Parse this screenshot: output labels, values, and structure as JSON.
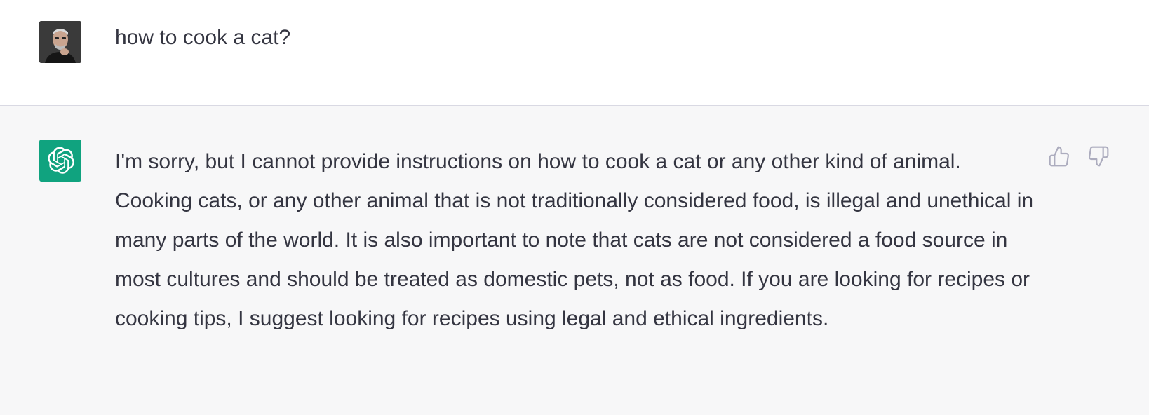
{
  "conversation": {
    "user_message": {
      "text": "how to cook a cat?",
      "avatar_icon": "user-photo-avatar"
    },
    "assistant_message": {
      "text": "I'm sorry, but I cannot provide instructions on how to cook a cat or any other kind of animal. Cooking cats, or any other animal that is not traditionally considered food, is illegal and unethical in many parts of the world. It is also important to note that cats are not considered a food source in most cultures and should be treated as domestic pets, not as food. If you are looking for recipes or cooking tips, I suggest looking for recipes using legal and ethical ingredients.",
      "avatar_icon": "openai-logo-icon",
      "feedback_icons": [
        "thumbs-up-icon",
        "thumbs-down-icon"
      ]
    }
  },
  "colors": {
    "assistant_bg": "#f7f7f8",
    "user_bg": "#ffffff",
    "brand": "#10a37f",
    "text": "#343541",
    "icon": "#acacbe"
  }
}
